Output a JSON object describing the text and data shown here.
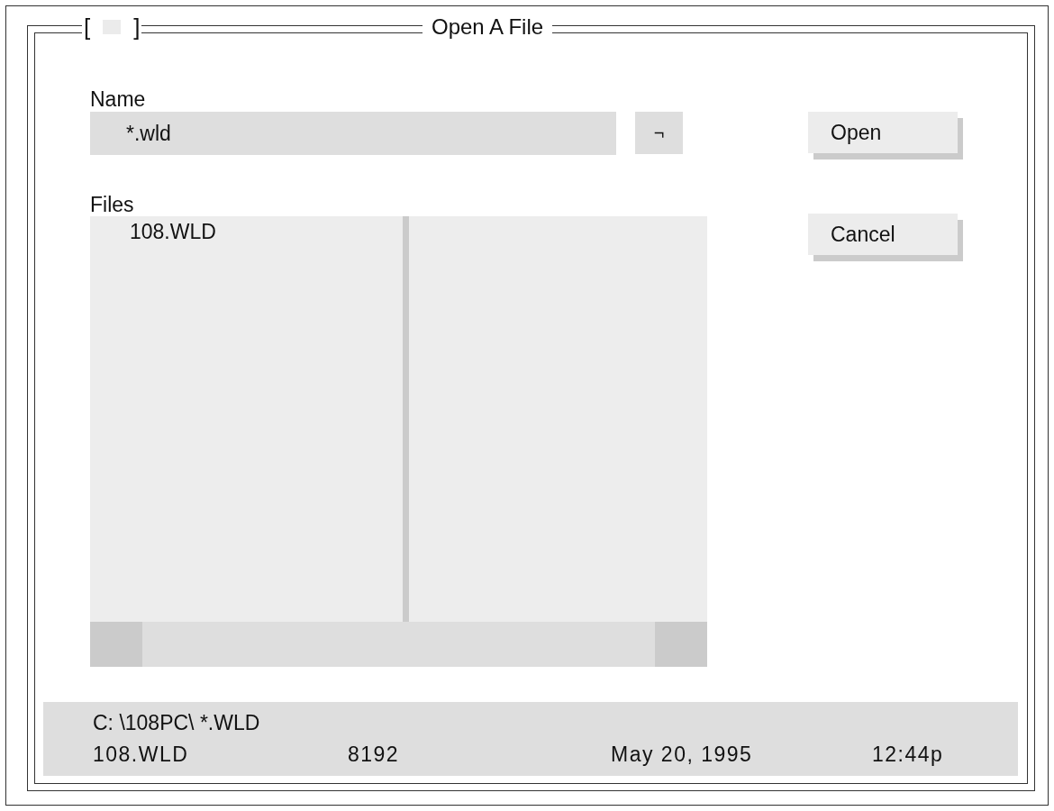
{
  "window": {
    "title": "Open A File",
    "close_box": {
      "left": "[",
      "right": "]"
    }
  },
  "name_field": {
    "label": "Name",
    "value": "*.wld"
  },
  "dropdown_button": {
    "label": "¬"
  },
  "buttons": [
    {
      "label": "Open"
    },
    {
      "label": "Cancel"
    }
  ],
  "files": {
    "label": "Files",
    "items": [
      "108.WLD"
    ]
  },
  "status": {
    "path": "C: \\108PC\\ *.WLD",
    "file": "108.WLD",
    "size": "8192",
    "date": "May 20, 1995",
    "time": "12:44p"
  }
}
